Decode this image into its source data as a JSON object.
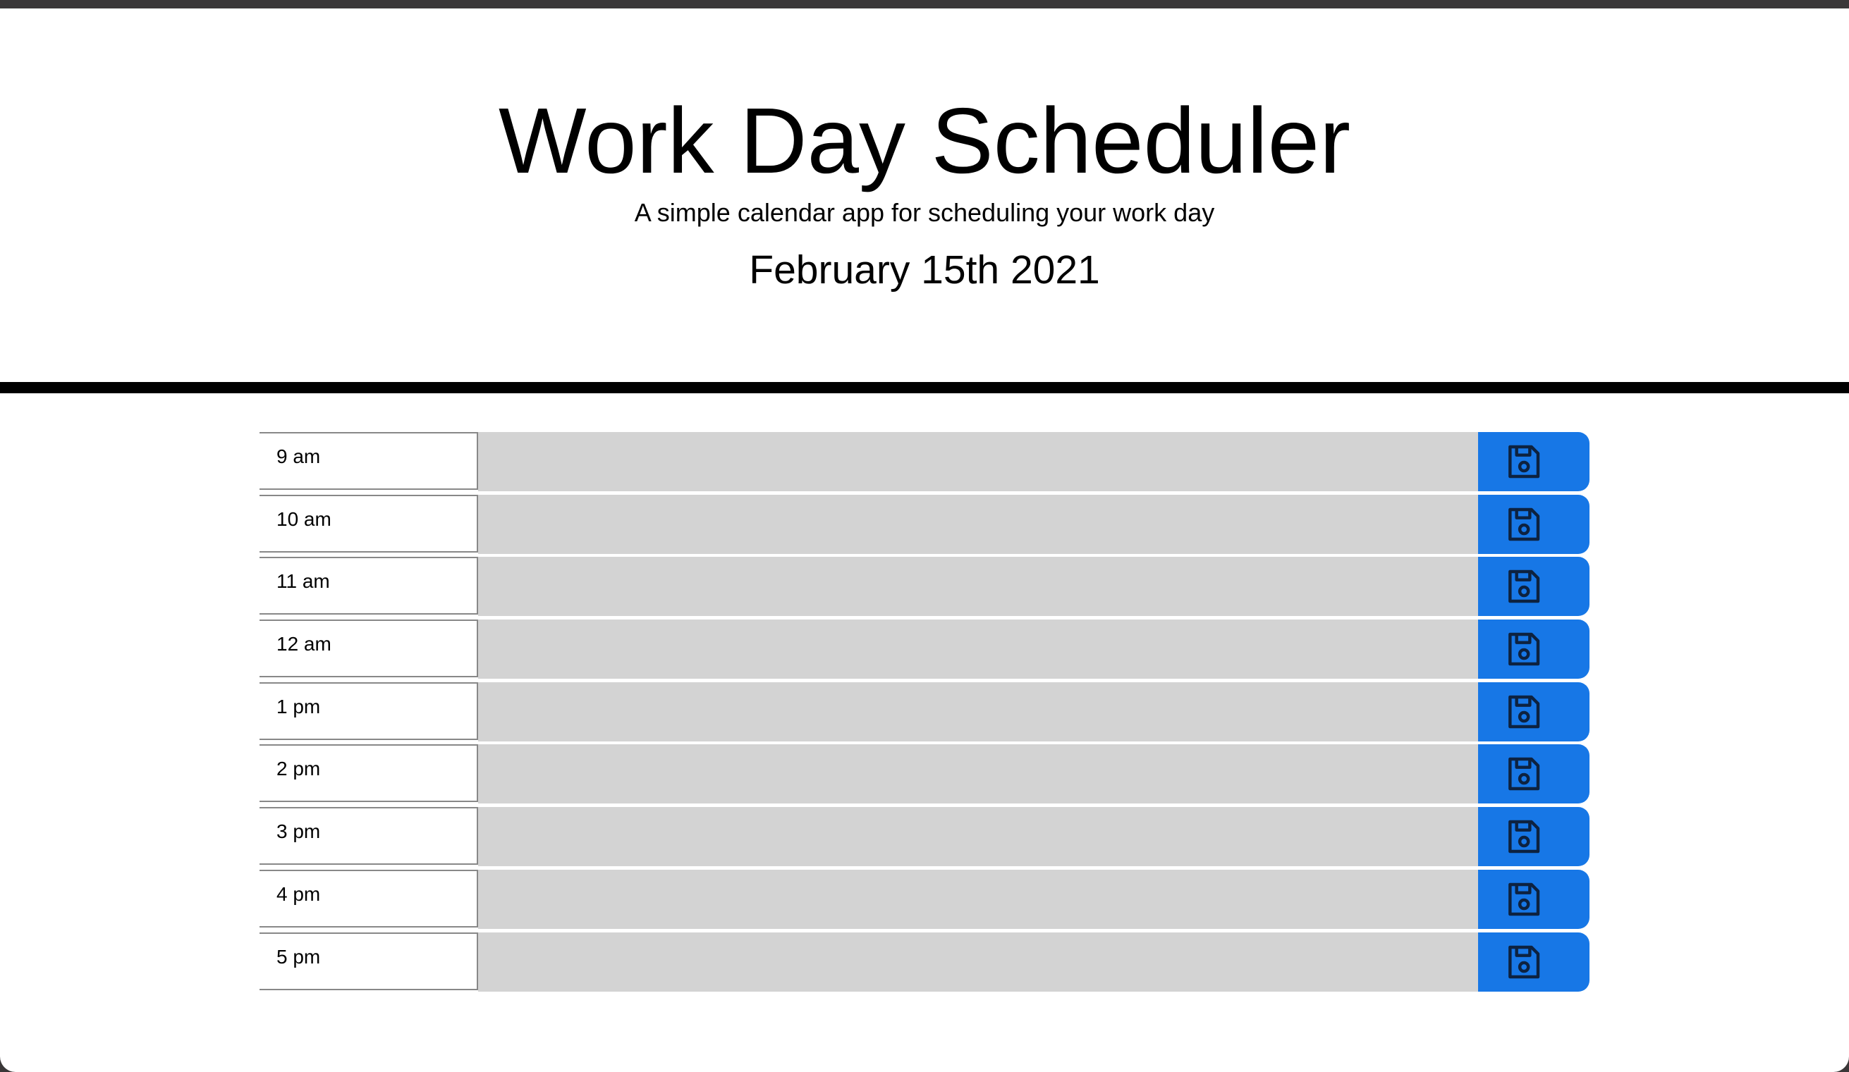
{
  "header": {
    "title": "Work Day Scheduler",
    "subtitle": "A simple calendar app for scheduling your work day",
    "date": "February 15th 2021"
  },
  "colors": {
    "past": "#d3d3d3",
    "save_button": "#1777e6",
    "icon": "#0d2240"
  },
  "icons": {
    "save": "floppy-disk-icon"
  },
  "timeblocks": [
    {
      "hour": "9 am",
      "text": ""
    },
    {
      "hour": "10 am",
      "text": ""
    },
    {
      "hour": "11 am",
      "text": ""
    },
    {
      "hour": "12 am",
      "text": ""
    },
    {
      "hour": "1 pm",
      "text": ""
    },
    {
      "hour": "2 pm",
      "text": ""
    },
    {
      "hour": "3 pm",
      "text": ""
    },
    {
      "hour": "4 pm",
      "text": ""
    },
    {
      "hour": "5 pm",
      "text": ""
    }
  ]
}
